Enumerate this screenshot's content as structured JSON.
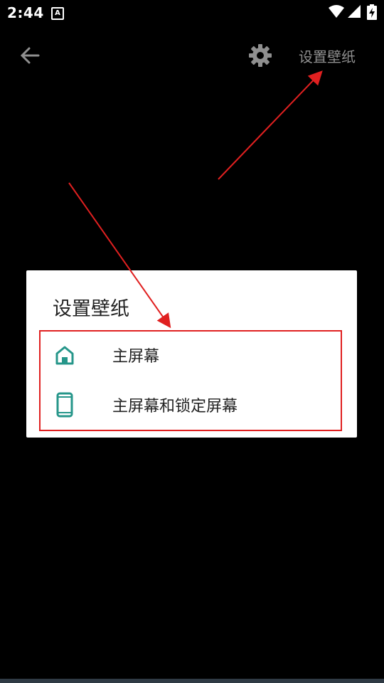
{
  "status_bar": {
    "time": "2:44",
    "notification_glyph": "A",
    "icons": [
      "wifi-icon",
      "signal-icon",
      "battery-charging-icon"
    ]
  },
  "top_bar": {
    "back_icon": "arrow-left-icon",
    "settings_icon": "gear-icon",
    "action_label": "设置壁纸"
  },
  "dialog": {
    "title": "设置壁纸",
    "options": [
      {
        "icon": "home-icon",
        "label": "主屏幕"
      },
      {
        "icon": "phone-icon",
        "label": "主屏幕和锁定屏幕"
      }
    ]
  },
  "colors": {
    "background": "#000000",
    "dialog_bg": "#ffffff",
    "accent_teal": "#26968a",
    "annotation_red": "#e02020",
    "top_bar_icon": "#8f8f8f"
  }
}
